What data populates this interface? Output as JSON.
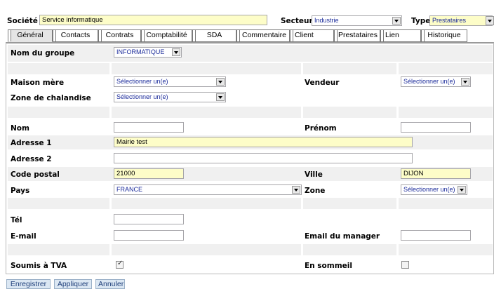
{
  "header": {
    "societe_label": "Société",
    "societe_value": "Service informatique",
    "secteur_label": "Secteur",
    "secteur_value": "Industrie",
    "type_label": "Type",
    "type_value": "Prestataires"
  },
  "tabs": [
    {
      "label": "Général",
      "active": true
    },
    {
      "label": "Contacts"
    },
    {
      "label": "Contrats"
    },
    {
      "label": "Comptabilité"
    },
    {
      "label": "SDA"
    },
    {
      "label": "Commentaire"
    },
    {
      "label": "Client"
    },
    {
      "label": "Prestataires"
    },
    {
      "label": "Lien"
    },
    {
      "label": "Historique"
    }
  ],
  "form": {
    "groupe_label": "Nom du groupe",
    "groupe_value": "INFORMATIQUE",
    "maison_label": "Maison mère",
    "maison_value": "Sélectionner un(e)",
    "vendeur_label": "Vendeur",
    "vendeur_value": "Sélectionner un(e)",
    "zone_chal_label": "Zone de chalandise",
    "zone_chal_value": "Sélectionner un(e)",
    "nom_label": "Nom",
    "nom_value": "",
    "prenom_label": "Prénom",
    "prenom_value": "",
    "adresse1_label": "Adresse 1",
    "adresse1_value": "Mairie test",
    "adresse2_label": "Adresse 2",
    "adresse2_value": "",
    "cp_label": "Code postal",
    "cp_value": "21000",
    "ville_label": "Ville",
    "ville_value": "DIJON",
    "pays_label": "Pays",
    "pays_value": "FRANCE",
    "zone_label": "Zone",
    "zone_value": "Sélectionner un(e)",
    "tel_label": "Tél",
    "tel_value": "",
    "email_label": "E-mail",
    "email_value": "",
    "email_manager_label": "Email du manager",
    "email_manager_value": "",
    "tva_label": "Soumis à TVA",
    "tva_checked": true,
    "sommeil_label": "En sommeil",
    "sommeil_checked": false
  },
  "buttons": {
    "save": "Enregistrer",
    "apply": "Appliquer",
    "cancel": "Annuler"
  }
}
